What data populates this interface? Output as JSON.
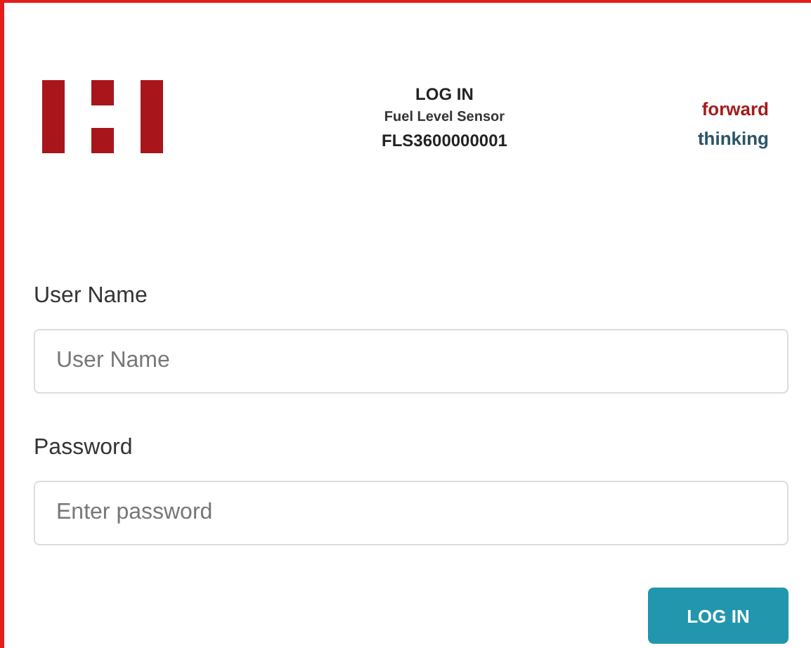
{
  "header": {
    "title": "LOG IN",
    "subtitle": "Fuel Level Sensor",
    "serial": "FLS3600000001",
    "tagline": [
      "forward",
      "thinking"
    ]
  },
  "fields": [
    {
      "label": "User Name",
      "placeholder": "User Name"
    },
    {
      "label": "Password",
      "placeholder": "Enter password"
    }
  ],
  "button": "LOG IN"
}
